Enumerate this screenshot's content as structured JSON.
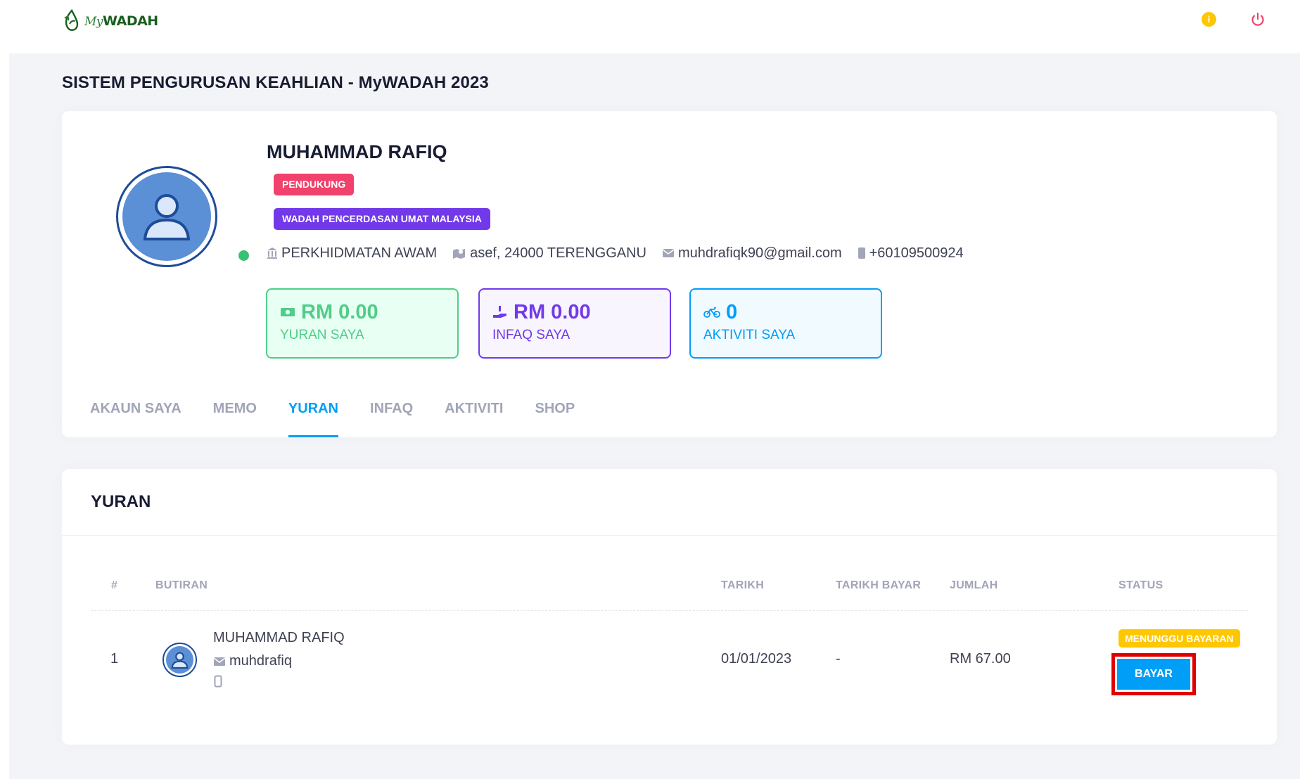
{
  "header": {
    "logo_my": "My",
    "logo_wadah": "WADAH",
    "info_icon_glyph": "i"
  },
  "page_title": "SISTEM PENGURUSAN KEAHLIAN - MyWADAH 2023",
  "profile": {
    "name": "MUHAMMAD RAFIQ",
    "badges": [
      "PENDUKUNG",
      "WADAH PENCERDASAN UMAT MALAYSIA"
    ],
    "sector": "PERKHIDMATAN AWAM",
    "address": "asef, 24000 TERENGGANU",
    "email": "muhdrafiqk90@gmail.com",
    "phone": "+60109500924",
    "online_color": "#38c172"
  },
  "stats": [
    {
      "value": "RM 0.00",
      "label": "YURAN SAYA",
      "icon": "money-icon",
      "color": "#50cd89"
    },
    {
      "value": "RM 0.00",
      "label": "INFAQ SAYA",
      "icon": "hand-holding-icon",
      "color": "#7239ea"
    },
    {
      "value": "0",
      "label": "AKTIVITI SAYA",
      "icon": "bicycle-icon",
      "color": "#009ef7"
    }
  ],
  "tabs": [
    "AKAUN SAYA",
    "MEMO",
    "YURAN",
    "INFAQ",
    "AKTIVITI",
    "SHOP"
  ],
  "active_tab": "YURAN",
  "yuran": {
    "title": "YURAN",
    "columns": [
      "#",
      "BUTIRAN",
      "TARIKH",
      "TARIKH BAYAR",
      "JUMLAH",
      "STATUS"
    ],
    "rows": [
      {
        "no": "1",
        "name": "MUHAMMAD RAFIQ",
        "username": "muhdrafiq",
        "date": "01/01/2023",
        "paid_date": "-",
        "amount": "RM 67.00",
        "status": "MENUNGGU BAYARAN",
        "action": "BAYAR"
      }
    ]
  },
  "colors": {
    "primary": "#009ef7",
    "success": "#50cd89",
    "danger": "#f1416c",
    "purple": "#7239ea",
    "warning": "#ffc700",
    "highlight_box": "#e00000"
  }
}
